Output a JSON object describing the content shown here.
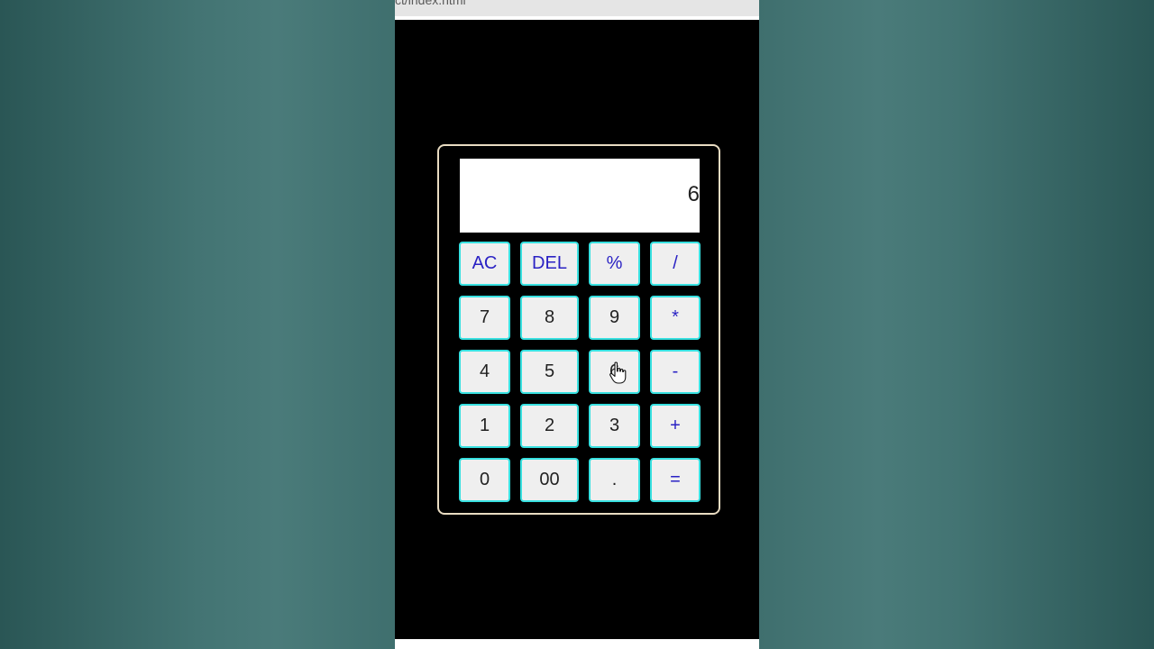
{
  "browser": {
    "address": "ct/index.html"
  },
  "display": {
    "value": "6"
  },
  "keys": [
    {
      "label": "AC"
    },
    {
      "label": "DEL"
    },
    {
      "label": "%"
    },
    {
      "label": "/"
    },
    {
      "label": "7"
    },
    {
      "label": "8"
    },
    {
      "label": "9"
    },
    {
      "label": "*"
    },
    {
      "label": "4"
    },
    {
      "label": "5"
    },
    {
      "label": "6"
    },
    {
      "label": "-"
    },
    {
      "label": "1"
    },
    {
      "label": "2"
    },
    {
      "label": "3"
    },
    {
      "label": "+"
    },
    {
      "label": "0"
    },
    {
      "label": "00"
    },
    {
      "label": "."
    },
    {
      "label": "="
    }
  ],
  "colors": {
    "key_border": "#38e0e0",
    "operator_text": "#2a22c4",
    "calculator_border": "#e9dcc2"
  }
}
